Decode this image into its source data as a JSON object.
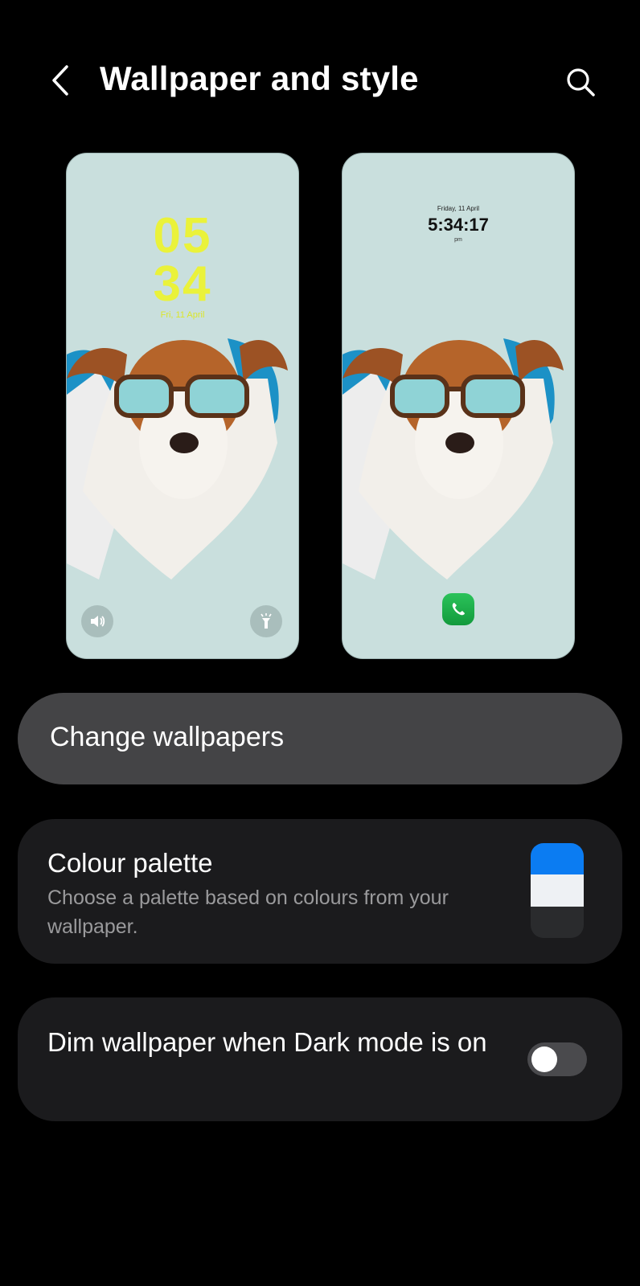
{
  "header": {
    "title": "Wallpaper and style",
    "back_icon": "chevron-left-icon",
    "search_icon": "search-icon"
  },
  "previews": {
    "lock_screen": {
      "hour": "05",
      "minute": "34",
      "date": "Fri, 11 April",
      "clock_color": "#eaf23a",
      "left_shortcut_icon": "volume-icon",
      "right_shortcut_icon": "flashlight-icon"
    },
    "home_screen": {
      "date": "Friday, 11 April",
      "time": "5:34:17",
      "ampm": "pm",
      "dock_icon": "phone-app-icon"
    },
    "background_color": "#c9dfdd"
  },
  "change_wallpapers": {
    "label": "Change wallpapers"
  },
  "colour_palette": {
    "title": "Colour palette",
    "description": "Choose a palette based on colours from your wallpaper.",
    "swatch_colors": [
      "#0b7cf2",
      "#eef1f4",
      "#2a2b2d"
    ]
  },
  "dim_wallpaper": {
    "title": "Dim wallpaper when Dark mode is on",
    "toggle_on": false
  },
  "colors": {
    "background": "#000000",
    "card": "#1b1b1d",
    "button": "#444446"
  }
}
